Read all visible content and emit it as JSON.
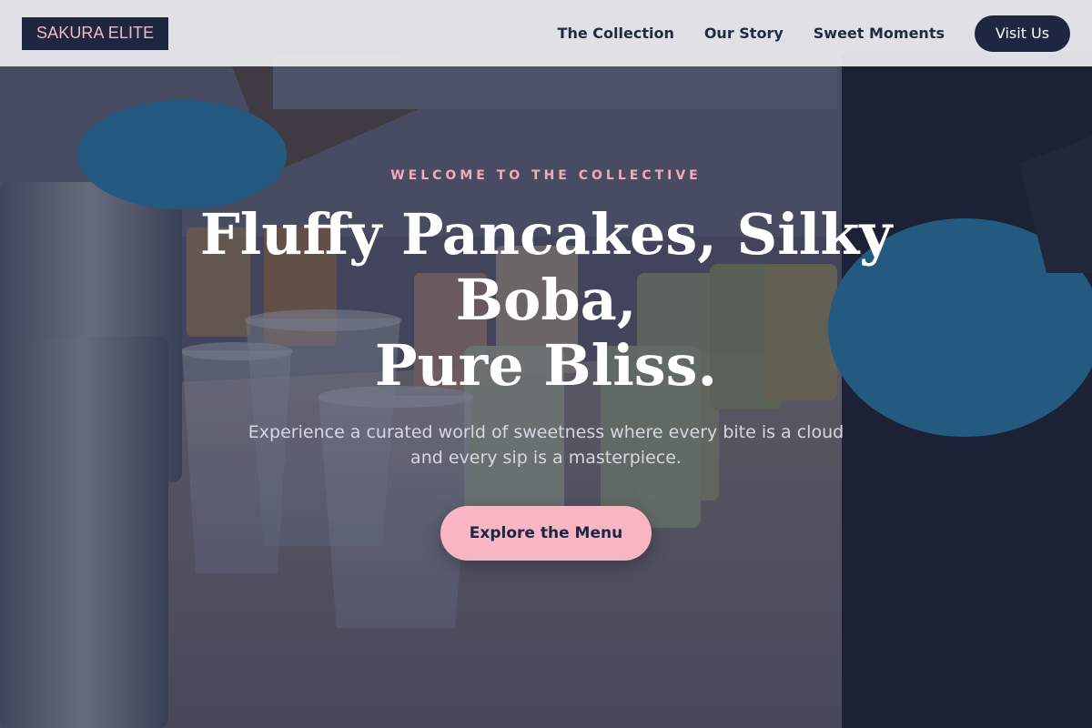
{
  "header": {
    "brand": "SAKURA ELITE",
    "nav_items": [
      {
        "label": "The Collection"
      },
      {
        "label": "Our Story"
      },
      {
        "label": "Sweet Moments"
      }
    ],
    "visit_label": "Visit Us"
  },
  "hero": {
    "eyebrow": "WELCOME TO THE COLLECTIVE",
    "headline_lines": [
      "Fluffy Pancakes, Silky",
      "Boba,",
      "Pure Bliss."
    ],
    "subtitle": "Experience a curated world of sweetness where every bite is a cloud and every sip is a masterpiece.",
    "cta_label": "Explore the Menu"
  },
  "colors": {
    "navy": "#1e2640",
    "pink": "#f8b5c3",
    "eyebrow_pink": "#f4aabb",
    "navbar_bg": "#ecedf0"
  },
  "icons": {
    "background_image": "boba-shop-photo"
  }
}
